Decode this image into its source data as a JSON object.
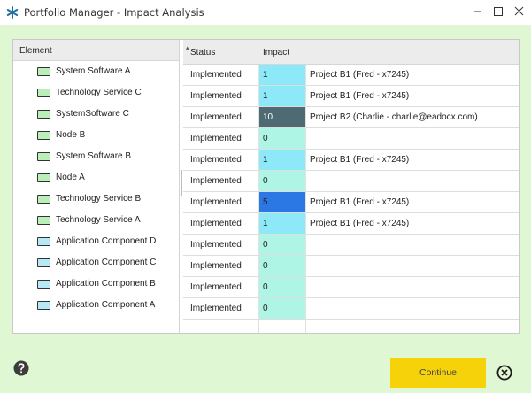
{
  "window": {
    "title": "Portfolio Manager - Impact Analysis"
  },
  "colors": {
    "background": "#dff7d2",
    "element_green": "#b9efb9",
    "element_blue": "#b5eaf5",
    "impact_low": "#aff5e6",
    "impact_cyan": "#8de9f7",
    "impact_mid": "#2b78e4",
    "impact_high": "#4e6b73",
    "continue_button": "#f5d20a"
  },
  "elements_header": "Element",
  "elements": [
    {
      "label": "System Software A",
      "type": "technology"
    },
    {
      "label": "Technology Service C",
      "type": "technology"
    },
    {
      "label": "SystemSoftware C",
      "type": "technology"
    },
    {
      "label": "Node B",
      "type": "technology"
    },
    {
      "label": "System Software B",
      "type": "technology"
    },
    {
      "label": "Node A",
      "type": "technology"
    },
    {
      "label": "Technology Service B",
      "type": "technology"
    },
    {
      "label": "Technology Service A",
      "type": "technology"
    },
    {
      "label": "Application Component D",
      "type": "application"
    },
    {
      "label": "Application Component C",
      "type": "application"
    },
    {
      "label": "Application Component B",
      "type": "application"
    },
    {
      "label": "Application Component A",
      "type": "application"
    }
  ],
  "grid": {
    "headers": {
      "status": "Status",
      "impact": "Impact"
    },
    "rows": [
      {
        "status": "Implemented",
        "impact": "1",
        "project": "Project B1 (Fred - x7245)"
      },
      {
        "status": "Implemented",
        "impact": "1",
        "project": "Project B1 (Fred - x7245)"
      },
      {
        "status": "Implemented",
        "impact": "10",
        "project": "Project B2 (Charlie - charlie@eadocx.com)"
      },
      {
        "status": "Implemented",
        "impact": "0",
        "project": ""
      },
      {
        "status": "Implemented",
        "impact": "1",
        "project": "Project B1 (Fred - x7245)"
      },
      {
        "status": "Implemented",
        "impact": "0",
        "project": ""
      },
      {
        "status": "Implemented",
        "impact": "5",
        "project": "Project B1 (Fred - x7245)"
      },
      {
        "status": "Implemented",
        "impact": "1",
        "project": "Project B1 (Fred - x7245)"
      },
      {
        "status": "Implemented",
        "impact": "0",
        "project": ""
      },
      {
        "status": "Implemented",
        "impact": "0",
        "project": ""
      },
      {
        "status": "Implemented",
        "impact": "0",
        "project": ""
      },
      {
        "status": "Implemented",
        "impact": "0",
        "project": ""
      }
    ]
  },
  "buttons": {
    "continue": "Continue",
    "help_icon": "help-icon",
    "cancel_icon": "close-circle-icon"
  }
}
